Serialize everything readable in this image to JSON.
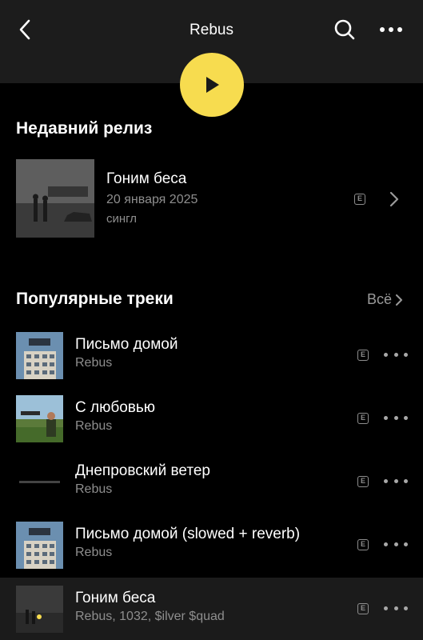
{
  "header": {
    "title": "Rebus",
    "back_icon": "back-chevron-icon",
    "search_icon": "search-icon",
    "more_icon": "more-horizontal-icon"
  },
  "play_button": {
    "icon": "play-icon",
    "color": "#f7dc4f"
  },
  "recent_release": {
    "section_title": "Недавний релиз",
    "title": "Гоним беса",
    "date": "20 января 2025",
    "type": "сингл",
    "explicit_badge": "E"
  },
  "popular": {
    "section_title": "Популярные треки",
    "see_all": "Всё",
    "tracks": [
      {
        "title": "Письмо домой",
        "artist": "Rebus",
        "explicit": "E"
      },
      {
        "title": "С любовью",
        "artist": "Rebus",
        "explicit": "E"
      },
      {
        "title": "Днепровский ветер",
        "artist": "Rebus",
        "explicit": "E"
      },
      {
        "title": "Письмо домой (slowed + reverb)",
        "artist": "Rebus",
        "explicit": "E"
      },
      {
        "title": "Гоним беса",
        "artist": "Rebus, 1032, $ilver $quad",
        "explicit": "E"
      }
    ]
  },
  "colors": {
    "accent": "#f7dc4f",
    "background": "#000000",
    "header_bg": "#1c1c1c",
    "secondary_text": "#8e8e8e"
  }
}
